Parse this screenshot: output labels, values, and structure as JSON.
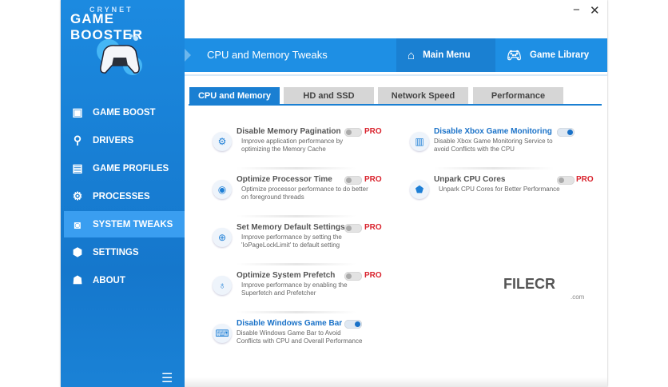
{
  "app": {
    "brand_top": "CRYNET",
    "brand_main": "GAME BOOSTER"
  },
  "sidebar": {
    "items": [
      {
        "label": "GAME BOOST",
        "icon": "monitor-boost-icon"
      },
      {
        "label": "DRIVERS",
        "icon": "search-icon"
      },
      {
        "label": "GAME PROFILES",
        "icon": "profile-icon"
      },
      {
        "label": "PROCESSES",
        "icon": "gears-icon"
      },
      {
        "label": "SYSTEM TWEAKS",
        "icon": "tweaks-icon"
      },
      {
        "label": "SETTINGS",
        "icon": "settings-icon"
      },
      {
        "label": "ABOUT",
        "icon": "about-icon"
      }
    ],
    "active": "SYSTEM TWEAKS"
  },
  "window": {
    "minimize": "−",
    "close": "✕"
  },
  "header": {
    "title": "CPU and Memory Tweaks",
    "main_menu": "Main Menu",
    "game_library": "Game Library"
  },
  "tabs": [
    "CPU and Memory",
    "HD and SSD",
    "Network Speed",
    "Performance"
  ],
  "tweaks_left": [
    {
      "title": "Disable Memory Pagination",
      "desc": "Improve application performance by optimizing the Memory Cache",
      "on": false,
      "pro": "PRO"
    },
    {
      "title": "Optimize Processor Time",
      "desc": "Optimize processor performance to do better on foreground threads",
      "on": false,
      "pro": "PRO"
    },
    {
      "title": "Set Memory Default Settings",
      "desc": "Improve performance by setting the 'IoPageLockLimit' to default setting",
      "on": false,
      "pro": "PRO"
    },
    {
      "title": "Optimize System Prefetch",
      "desc": "Improve performance by enabling the Superfetch and Prefetcher",
      "on": false,
      "pro": "PRO"
    },
    {
      "title": "Disable Windows Game Bar",
      "desc": "Disable Windows Game Bar to Avoid Conflicts with CPU and Overall Performance",
      "on": true
    }
  ],
  "tweaks_right": [
    {
      "title": "Disable Xbox Game Monitoring",
      "desc": "Disable Xbox Game Monitoring Service to avoid Conflicts with the CPU",
      "on": true
    },
    {
      "title": "Unpark CPU Cores",
      "desc": "Unpark CPU Cores for Better Performance",
      "on": false,
      "pro": "PRO"
    }
  ],
  "watermark": {
    "text": "FILECR",
    "sub": ".com"
  }
}
